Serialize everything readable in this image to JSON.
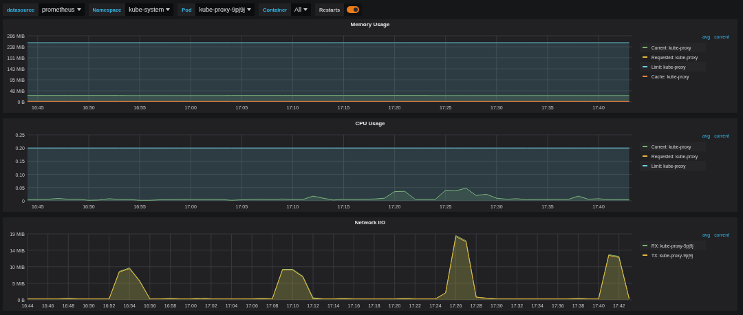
{
  "variables": [
    {
      "kind": "select",
      "label": "datasource",
      "value": "prometheus"
    },
    {
      "kind": "select",
      "label": "Namespace",
      "value": "kube-system"
    },
    {
      "kind": "select",
      "label": "Pod",
      "value": "kube-proxy-9pj9j"
    },
    {
      "kind": "select",
      "label": "Container",
      "value": "All"
    },
    {
      "kind": "switch",
      "label": "Restarts",
      "on": true
    }
  ],
  "panels": [
    {
      "title": "Memory Usage",
      "legend_columns": [
        "avg",
        "current"
      ],
      "chart_data": {
        "type": "area",
        "grid": true,
        "categories": [
          null,
          "16:45",
          null,
          null,
          null,
          null,
          "16:50",
          null,
          null,
          null,
          null,
          "16:55",
          null,
          null,
          null,
          null,
          "17:00",
          null,
          null,
          null,
          null,
          "17:05",
          null,
          null,
          null,
          null,
          "17:10",
          null,
          null,
          null,
          null,
          "17:15",
          null,
          null,
          null,
          null,
          "17:20",
          null,
          null,
          null,
          null,
          "17:25",
          null,
          null,
          null,
          null,
          "17:30",
          null,
          null,
          null,
          null,
          "17:35",
          null,
          null,
          null,
          null,
          "17:40",
          null,
          null,
          null
        ],
        "ylim": [
          0,
          286
        ],
        "yticks": [
          {
            "value": 0,
            "label": "0 B"
          },
          {
            "value": 47.7,
            "label": "48 MiB"
          },
          {
            "value": 95.3,
            "label": "95 MiB"
          },
          {
            "value": 143,
            "label": "143 MiB"
          },
          {
            "value": 190.7,
            "label": "191 MiB"
          },
          {
            "value": 238.3,
            "label": "238 MiB"
          },
          {
            "value": 286,
            "label": "286 MiB"
          }
        ],
        "series": [
          {
            "name": "Current: kube-proxy",
            "color": "#7eb26d",
            "values": [
              28,
              28,
              28,
              28,
              28,
              28,
              28,
              28,
              28,
              28,
              27,
              27,
              27,
              27,
              27,
              27,
              27,
              27,
              27,
              27,
              28,
              28,
              28,
              28,
              28,
              28,
              28,
              28,
              28,
              28,
              28,
              28,
              28,
              28,
              28,
              28,
              28,
              28,
              28,
              28,
              27,
              27,
              27,
              27,
              27,
              27,
              27,
              27,
              27,
              27,
              27,
              27,
              27,
              27,
              27,
              27,
              27,
              27,
              27,
              27
            ]
          },
          {
            "name": "Requested: kube-proxy",
            "color": "#eab839",
            "values": [
              null,
              null,
              null,
              null,
              null,
              null,
              null,
              null,
              null,
              null,
              null,
              null,
              null,
              null,
              null,
              null,
              null,
              null,
              null,
              null,
              null,
              null,
              null,
              null,
              null,
              null,
              null,
              null,
              null,
              null,
              null,
              null,
              null,
              null,
              null,
              null,
              null,
              null,
              null,
              null,
              null,
              null,
              null,
              null,
              null,
              null,
              null,
              null,
              null,
              null,
              null,
              null,
              null,
              null,
              null,
              null,
              null,
              null,
              null,
              null
            ]
          },
          {
            "name": "Limit: kube-proxy",
            "color": "#6ed0e0",
            "values": [
              256,
              256,
              256,
              256,
              256,
              256,
              256,
              256,
              256,
              256,
              256,
              256,
              256,
              256,
              256,
              256,
              256,
              256,
              256,
              256,
              256,
              256,
              256,
              256,
              256,
              256,
              256,
              256,
              256,
              256,
              256,
              256,
              256,
              256,
              256,
              256,
              256,
              256,
              256,
              256,
              256,
              256,
              256,
              256,
              256,
              256,
              256,
              256,
              256,
              256,
              256,
              256,
              256,
              256,
              256,
              256,
              256,
              256,
              256,
              256
            ]
          },
          {
            "name": "Cache: kube-proxy",
            "color": "#ef843c",
            "values": [
              2,
              2,
              2,
              2,
              2,
              2,
              2,
              2,
              2,
              2,
              2,
              2,
              2,
              2,
              2,
              2,
              2,
              2,
              2,
              2,
              2,
              2,
              2,
              2,
              2,
              2,
              2,
              2,
              2,
              2,
              2,
              2,
              2,
              2,
              2,
              2,
              2,
              2,
              2,
              2,
              2,
              2,
              2,
              2,
              2,
              2,
              2,
              2,
              2,
              2,
              2,
              2,
              2,
              2,
              2,
              2,
              2,
              2,
              2,
              2
            ]
          }
        ]
      }
    },
    {
      "title": "CPU Usage",
      "legend_columns": [
        "avg",
        "current"
      ],
      "chart_data": {
        "type": "area",
        "grid": true,
        "categories": [
          null,
          "16:45",
          null,
          null,
          null,
          null,
          "16:50",
          null,
          null,
          null,
          null,
          "16:55",
          null,
          null,
          null,
          null,
          "17:00",
          null,
          null,
          null,
          null,
          "17:05",
          null,
          null,
          null,
          null,
          "17:10",
          null,
          null,
          null,
          null,
          "17:15",
          null,
          null,
          null,
          null,
          "17:20",
          null,
          null,
          null,
          null,
          "17:25",
          null,
          null,
          null,
          null,
          "17:30",
          null,
          null,
          null,
          null,
          "17:35",
          null,
          null,
          null,
          null,
          "17:40",
          null,
          null,
          null
        ],
        "ylim": [
          0,
          0.25
        ],
        "yticks": [
          {
            "value": 0,
            "label": "0"
          },
          {
            "value": 0.05,
            "label": "0.05"
          },
          {
            "value": 0.1,
            "label": "0.10"
          },
          {
            "value": 0.15,
            "label": "0.15"
          },
          {
            "value": 0.2,
            "label": "0.20"
          },
          {
            "value": 0.25,
            "label": "0.25"
          }
        ],
        "series": [
          {
            "name": "Current: kube-proxy",
            "color": "#7eb26d",
            "values": [
              0.005,
              0.005,
              0.006,
              0.009,
              0.006,
              0.006,
              0.002,
              0.003,
              0.008,
              0.005,
              0.005,
              0.002,
              0.002,
              0.004,
              0.005,
              0.005,
              0.006,
              0.005,
              0.006,
              0.005,
              0.002,
              0.004,
              0.006,
              0.006,
              0.005,
              0.007,
              0.005,
              0.005,
              0.018,
              0.01,
              0.003,
              0.006,
              0.005,
              0.006,
              0.007,
              0.01,
              0.035,
              0.036,
              0.006,
              0.005,
              0.006,
              0.04,
              0.038,
              0.048,
              0.02,
              0.025,
              0.01,
              0.006,
              0.008,
              0.004,
              0.006,
              0.005,
              0.006,
              0.005,
              0.018,
              0.006,
              0.008,
              0.004,
              0.005,
              0.004
            ]
          },
          {
            "name": "Requested: kube-proxy",
            "color": "#eab839",
            "values": [
              null,
              null,
              null,
              null,
              null,
              null,
              null,
              null,
              null,
              null,
              null,
              null,
              null,
              null,
              null,
              null,
              null,
              null,
              null,
              null,
              null,
              null,
              null,
              null,
              null,
              null,
              null,
              null,
              null,
              null,
              null,
              null,
              null,
              null,
              null,
              null,
              null,
              null,
              null,
              null,
              null,
              null,
              null,
              null,
              null,
              null,
              null,
              null,
              null,
              null,
              null,
              null,
              null,
              null,
              null,
              null,
              null,
              null,
              null,
              null
            ]
          },
          {
            "name": "Limit: kube-proxy",
            "color": "#6ed0e0",
            "values": [
              0.2,
              0.2,
              0.2,
              0.2,
              0.2,
              0.2,
              0.2,
              0.2,
              0.2,
              0.2,
              0.2,
              0.2,
              0.2,
              0.2,
              0.2,
              0.2,
              0.2,
              0.2,
              0.2,
              0.2,
              0.2,
              0.2,
              0.2,
              0.2,
              0.2,
              0.2,
              0.2,
              0.2,
              0.2,
              0.2,
              0.2,
              0.2,
              0.2,
              0.2,
              0.2,
              0.2,
              0.2,
              0.2,
              0.2,
              0.2,
              0.2,
              0.2,
              0.2,
              0.2,
              0.2,
              0.2,
              0.2,
              0.2,
              0.2,
              0.2,
              0.2,
              0.2,
              0.2,
              0.2,
              0.2,
              0.2,
              0.2,
              0.2,
              0.2,
              0.2
            ]
          }
        ]
      }
    },
    {
      "title": "Network I/O",
      "legend_columns": [
        "avg",
        "current"
      ],
      "chart_data": {
        "type": "area",
        "grid": true,
        "categories": [
          "16:44",
          null,
          "16:46",
          null,
          "16:48",
          null,
          "16:50",
          null,
          "16:52",
          null,
          "16:54",
          null,
          "16:56",
          null,
          "16:58",
          null,
          "17:00",
          null,
          "17:02",
          null,
          "17:04",
          null,
          "17:06",
          null,
          "17:08",
          null,
          "17:10",
          null,
          "17:12",
          null,
          "17:14",
          null,
          "17:16",
          null,
          "17:18",
          null,
          "17:20",
          null,
          "17:22",
          null,
          "17:24",
          null,
          "17:26",
          null,
          "17:28",
          null,
          "17:30",
          null,
          "17:32",
          null,
          "17:34",
          null,
          "17:36",
          null,
          "17:38",
          null,
          "17:40",
          null,
          "17:42",
          null
        ],
        "ylim": [
          0,
          19
        ],
        "yticks": [
          {
            "value": 0,
            "label": "0 B"
          },
          {
            "value": 4.77,
            "label": "5 MiB"
          },
          {
            "value": 9.54,
            "label": "10 MiB"
          },
          {
            "value": 14.3,
            "label": "14 MiB"
          },
          {
            "value": 19,
            "label": "19 MiB"
          }
        ],
        "series": [
          {
            "name": "RX: kube-proxy-9pj9j",
            "color": "#7eb26d",
            "values": [
              0.3,
              0.3,
              0.3,
              0.3,
              0.4,
              0.3,
              0.3,
              0.3,
              0.3,
              8.2,
              9.2,
              5.5,
              0.3,
              0.3,
              0.4,
              0.3,
              0.3,
              0.5,
              0.3,
              0.3,
              0.3,
              0.3,
              0.3,
              0.4,
              0.3,
              8.8,
              8.8,
              6.8,
              0.6,
              0.3,
              0.3,
              0.4,
              0.3,
              0.3,
              0.3,
              0.3,
              0.3,
              0.4,
              0.3,
              0.3,
              0.3,
              2,
              18.5,
              17,
              0.8,
              0.5,
              0.3,
              0.3,
              0.3,
              0.3,
              0.3,
              0.3,
              0.3,
              0.3,
              0.4,
              0.3,
              0.3,
              13,
              12.5,
              0.3
            ]
          },
          {
            "name": "TX: kube-proxy-9pj9j",
            "color": "#eab839",
            "values": [
              0.3,
              0.3,
              0.3,
              0.3,
              0.4,
              0.3,
              0.3,
              0.3,
              0.3,
              8,
              9,
              5.3,
              0.3,
              0.3,
              0.4,
              0.3,
              0.3,
              0.5,
              0.3,
              0.3,
              0.3,
              0.3,
              0.3,
              0.4,
              0.3,
              8.6,
              8.6,
              6.6,
              0.3,
              0.3,
              0.3,
              0.4,
              0.3,
              0.3,
              0.3,
              0.3,
              0.3,
              0.4,
              0.3,
              0.3,
              0.3,
              2,
              18.2,
              16.7,
              0.8,
              0.5,
              0.3,
              0.3,
              0.3,
              0.3,
              0.3,
              0.3,
              0.3,
              0.3,
              0.4,
              0.3,
              0.3,
              12.8,
              12.2,
              0.3
            ]
          }
        ]
      }
    }
  ]
}
